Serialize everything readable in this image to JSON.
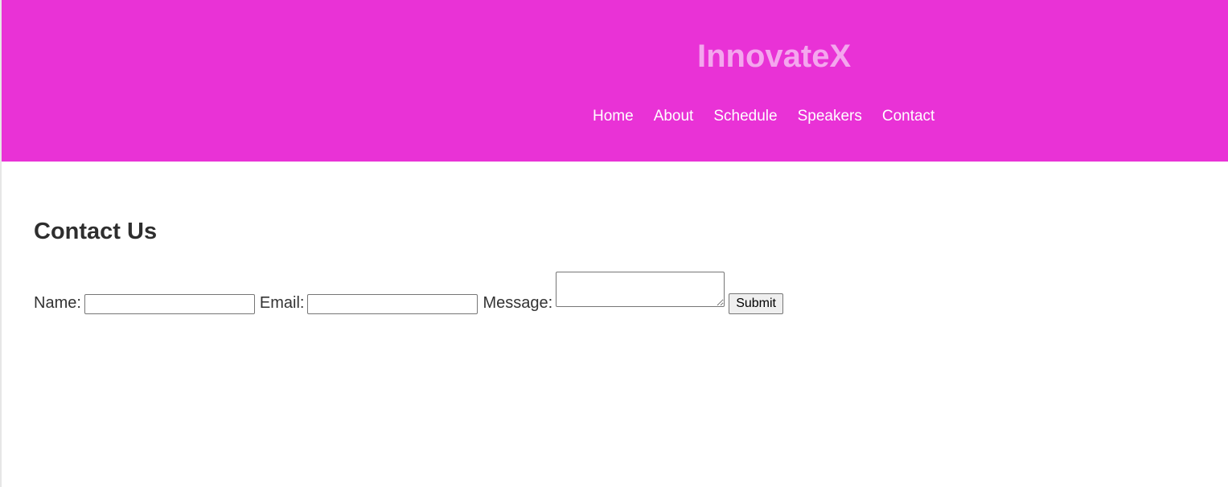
{
  "header": {
    "site_title": "InnovateX",
    "nav": [
      {
        "label": "Home"
      },
      {
        "label": "About"
      },
      {
        "label": "Schedule"
      },
      {
        "label": "Speakers"
      },
      {
        "label": "Contact"
      }
    ]
  },
  "contact": {
    "heading": "Contact Us",
    "name_label": "Name:",
    "name_value": "",
    "email_label": "Email:",
    "email_value": "",
    "message_label": "Message:",
    "message_value": "",
    "submit_label": "Submit"
  },
  "colors": {
    "header_bg": "#e932d6",
    "title_color": "#f4a6ee",
    "nav_text": "#ffffff",
    "heading_text": "#2e2e2e"
  }
}
